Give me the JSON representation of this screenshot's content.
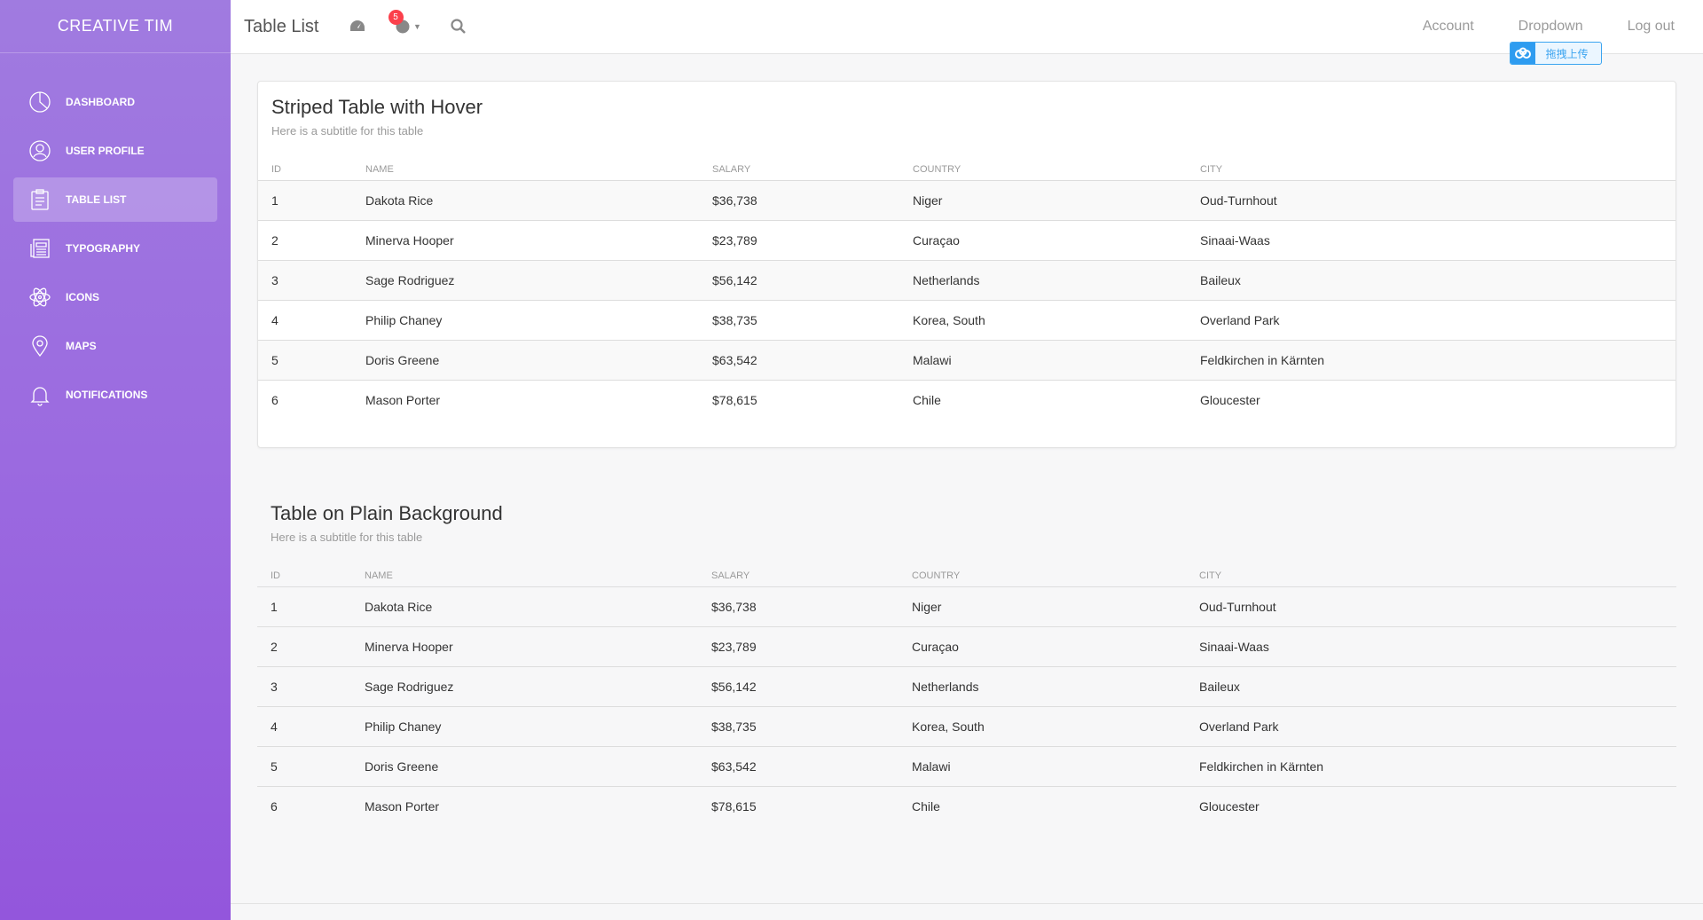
{
  "brand": "CREATIVE TIM",
  "sidebar": {
    "items": [
      {
        "label": "DASHBOARD",
        "icon": "pie-chart-icon"
      },
      {
        "label": "USER PROFILE",
        "icon": "user-icon"
      },
      {
        "label": "TABLE LIST",
        "icon": "clipboard-icon",
        "active": true
      },
      {
        "label": "TYPOGRAPHY",
        "icon": "news-paper-icon"
      },
      {
        "label": "ICONS",
        "icon": "atom-icon"
      },
      {
        "label": "MAPS",
        "icon": "map-pin-icon"
      },
      {
        "label": "NOTIFICATIONS",
        "icon": "bell-icon"
      }
    ]
  },
  "navbar": {
    "title": "Table List",
    "notification_count": "5",
    "links": {
      "account": "Account",
      "dropdown": "Dropdown",
      "logout": "Log out"
    },
    "upload_widget_label": "拖拽上传"
  },
  "table_columns": [
    "ID",
    "Name",
    "Salary",
    "Country",
    "City"
  ],
  "striped_table": {
    "title": "Striped Table with Hover",
    "subtitle": "Here is a subtitle for this table",
    "rows": [
      [
        "1",
        "Dakota Rice",
        "$36,738",
        "Niger",
        "Oud-Turnhout"
      ],
      [
        "2",
        "Minerva Hooper",
        "$23,789",
        "Curaçao",
        "Sinaai-Waas"
      ],
      [
        "3",
        "Sage Rodriguez",
        "$56,142",
        "Netherlands",
        "Baileux"
      ],
      [
        "4",
        "Philip Chaney",
        "$38,735",
        "Korea, South",
        "Overland Park"
      ],
      [
        "5",
        "Doris Greene",
        "$63,542",
        "Malawi",
        "Feldkirchen in Kärnten"
      ],
      [
        "6",
        "Mason Porter",
        "$78,615",
        "Chile",
        "Gloucester"
      ]
    ]
  },
  "plain_table": {
    "title": "Table on Plain Background",
    "subtitle": "Here is a subtitle for this table",
    "rows": [
      [
        "1",
        "Dakota Rice",
        "$36,738",
        "Niger",
        "Oud-Turnhout"
      ],
      [
        "2",
        "Minerva Hooper",
        "$23,789",
        "Curaçao",
        "Sinaai-Waas"
      ],
      [
        "3",
        "Sage Rodriguez",
        "$56,142",
        "Netherlands",
        "Baileux"
      ],
      [
        "4",
        "Philip Chaney",
        "$38,735",
        "Korea, South",
        "Overland Park"
      ],
      [
        "5",
        "Doris Greene",
        "$63,542",
        "Malawi",
        "Feldkirchen in Kärnten"
      ],
      [
        "6",
        "Mason Porter",
        "$78,615",
        "Chile",
        "Gloucester"
      ]
    ]
  },
  "colors": {
    "sidebar_top": "#a07be0",
    "sidebar_bottom": "#9356dc",
    "badge": "#fb404b",
    "upload_accent": "#3ba4f0"
  }
}
